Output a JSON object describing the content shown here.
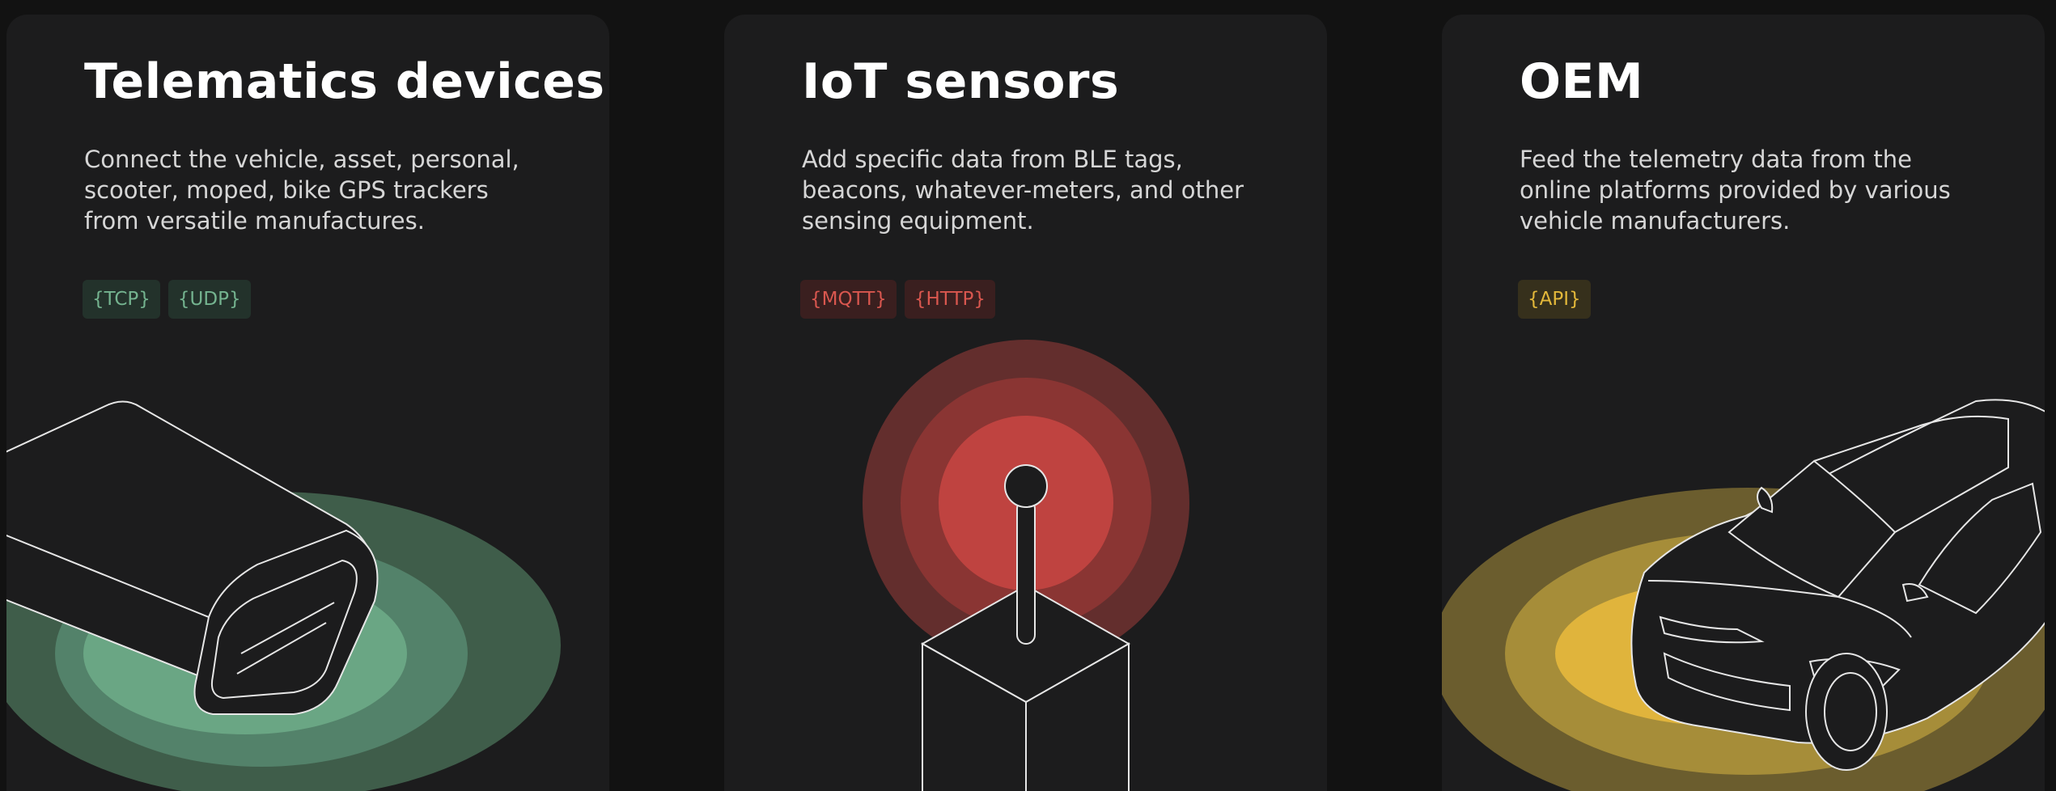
{
  "cards": [
    {
      "title": "Telematics devices",
      "description": "Connect the vehicle, asset, personal, scooter, moped, bike GPS trackers from versatile manufactures.",
      "tags": [
        "{TCP}",
        "{UDP}"
      ],
      "accent": "#6fa886"
    },
    {
      "title": "IoT sensors",
      "description": "Add specific data from BLE tags, beacons, whatever-meters, and other sensing equipment.",
      "tags": [
        "{MQTT}",
        "{HTTP}"
      ],
      "accent": "#d9574f"
    },
    {
      "title": "OEM",
      "description": "Feed the telemetry data from the online platforms provided by various vehicle manufacturers.",
      "tags": [
        "{API}"
      ],
      "accent": "#e3b83a"
    }
  ],
  "icons": {
    "card1": "obd-tracker-device-icon",
    "card2": "iot-sensor-beacon-icon",
    "card3": "car-icon"
  }
}
